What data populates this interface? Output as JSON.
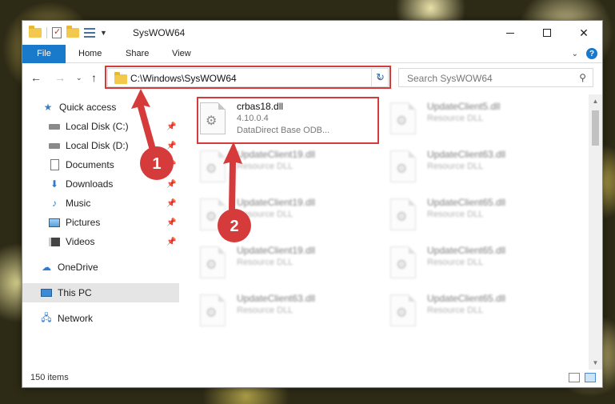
{
  "window": {
    "title": "SysWOW64",
    "controls": {
      "minimize": "─",
      "maximize": "☐",
      "close": "✕"
    }
  },
  "ribbon": {
    "tabs": [
      "File",
      "Home",
      "Share",
      "View"
    ],
    "expand_chevron": "⌄",
    "help": "?"
  },
  "nav": {
    "back": "←",
    "forward": "→",
    "recent": "⌄",
    "up": "↑",
    "address": "C:\\Windows\\SysWOW64",
    "address_dropdown": "⌄",
    "refresh": "↻",
    "search_placeholder": "Search SysWOW64",
    "search_icon": "⚲"
  },
  "navpane": {
    "items": [
      {
        "label": "Quick access",
        "icon": "star-icon",
        "pinned": false
      },
      {
        "label": "Local Disk (C:)",
        "icon": "disk-icon",
        "pinned": true
      },
      {
        "label": "Local Disk (D:)",
        "icon": "disk-icon",
        "pinned": true
      },
      {
        "label": "Documents",
        "icon": "documents-icon",
        "pinned": true
      },
      {
        "label": "Downloads",
        "icon": "downloads-icon",
        "pinned": true
      },
      {
        "label": "Music",
        "icon": "music-icon",
        "pinned": true
      },
      {
        "label": "Pictures",
        "icon": "pictures-icon",
        "pinned": true
      },
      {
        "label": "Videos",
        "icon": "videos-icon",
        "pinned": true
      },
      {
        "label": "OneDrive",
        "icon": "onedrive-icon",
        "pinned": false
      },
      {
        "label": "This PC",
        "icon": "this-pc-icon",
        "pinned": false,
        "selected": true
      },
      {
        "label": "Network",
        "icon": "network-icon",
        "pinned": false
      }
    ],
    "pin_glyph": "📌"
  },
  "files": {
    "highlighted": {
      "name": "crbas18.dll",
      "version": "4.10.0.4",
      "description": "DataDirect Base ODB..."
    },
    "blurred": [
      {
        "name": "UpdateClient5.dll",
        "type": "Resource DLL"
      },
      {
        "name": "UpdateClient19.dll",
        "type": "Resource DLL"
      },
      {
        "name": "UpdateClient63.dll",
        "type": "Resource DLL"
      },
      {
        "name": "UpdateClient19.dll",
        "type": "Resource DLL"
      },
      {
        "name": "UpdateClient65.dll",
        "type": "Resource DLL"
      },
      {
        "name": "UpdateClient19.dll",
        "type": "Resource DLL"
      },
      {
        "name": "UpdateClient65.dll",
        "type": "Resource DLL"
      },
      {
        "name": "UpdateClient63.dll",
        "type": "Resource DLL"
      },
      {
        "name": "UpdateClient65.dll",
        "type": "Resource DLL"
      }
    ]
  },
  "status": {
    "item_count": "150 items"
  },
  "annotations": {
    "step1": "1",
    "step2": "2",
    "color": "#d63b3b"
  }
}
